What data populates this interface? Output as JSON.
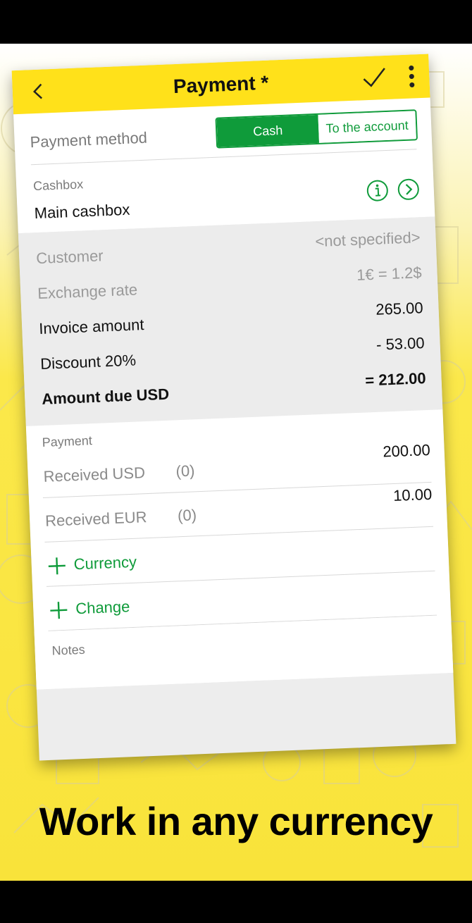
{
  "appbar": {
    "title": "Payment *",
    "back_icon": "chevron-left-icon",
    "confirm_icon": "check-icon",
    "menu_icon": "more-vertical-icon"
  },
  "payment_method": {
    "label": "Payment method",
    "options": [
      "Cash",
      "To the account"
    ],
    "selected": "Cash"
  },
  "cashbox": {
    "label": "Cashbox",
    "value": "Main cashbox"
  },
  "summary": {
    "customer_label": "Customer",
    "customer_value": "<not specified>",
    "rate_label": "Exchange rate",
    "rate_value": "1€ = 1.2$",
    "invoice_label": "Invoice amount",
    "invoice_value": "265.00",
    "discount_label": "Discount 20%",
    "discount_value": "- 53.00",
    "due_label": "Amount due USD",
    "due_value": "= 212.00"
  },
  "payment": {
    "section_label": "Payment",
    "rows": [
      {
        "label": "Received USD",
        "count": "(0)",
        "value": "200.00"
      },
      {
        "label": "Received EUR",
        "count": "(0)",
        "value": "10.00"
      }
    ],
    "add_currency": "Currency",
    "add_change": "Change",
    "notes_label": "Notes"
  },
  "caption": "Work in any currency",
  "colors": {
    "accent": "#0f9b3a",
    "appbar": "#ffe11a",
    "background_yellow": "#f9e33a"
  }
}
